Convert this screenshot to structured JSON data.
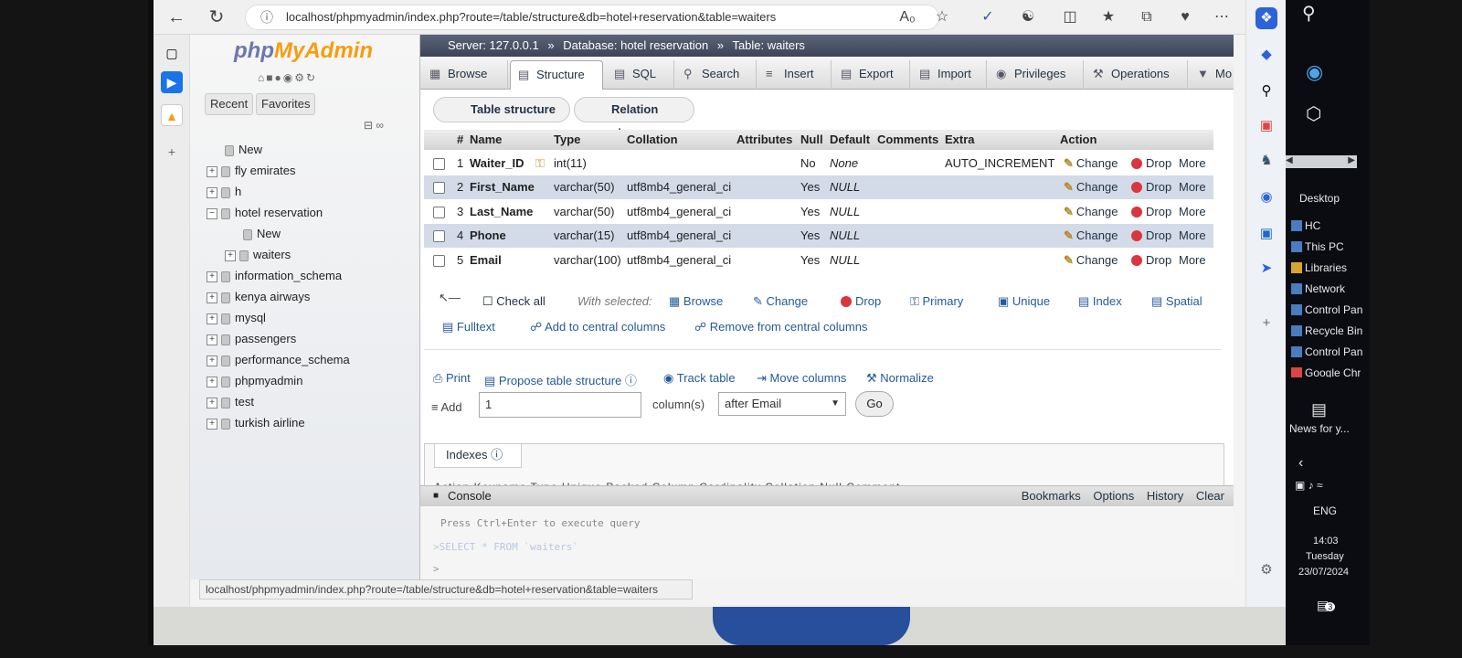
{
  "browser": {
    "url": "localhost/phpmyadmin/index.php?route=/table/structure&db=hotel+reservation&table=waiters"
  },
  "pma": {
    "logo_php": "php",
    "logo_myadmin": "MyAdmin",
    "left_tabs": [
      "Recent",
      "Favorites"
    ],
    "tree": [
      {
        "label": "New",
        "indent": 0
      },
      {
        "label": "fly emirates",
        "indent": 0
      },
      {
        "label": "h",
        "indent": 0
      },
      {
        "label": "hotel reservation",
        "indent": 0
      },
      {
        "label": "New",
        "indent": 1
      },
      {
        "label": "waiters",
        "indent": 1
      },
      {
        "label": "information_schema",
        "indent": 0
      },
      {
        "label": "kenya airways",
        "indent": 0
      },
      {
        "label": "mysql",
        "indent": 0
      },
      {
        "label": "passengers",
        "indent": 0
      },
      {
        "label": "performance_schema",
        "indent": 0
      },
      {
        "label": "phpmyadmin",
        "indent": 0
      },
      {
        "label": "test",
        "indent": 0
      },
      {
        "label": "turkish airline",
        "indent": 0
      }
    ],
    "breadcrumb": {
      "server": "Server: 127.0.0.1",
      "database": "Database: hotel reservation",
      "table": "Table: waiters"
    },
    "tabs": [
      "Browse",
      "Structure",
      "SQL",
      "Search",
      "Insert",
      "Export",
      "Import",
      "Privileges",
      "Operations",
      "Mo"
    ],
    "active_tab": "Structure",
    "subtabs": [
      "Table structure",
      "Relation view"
    ],
    "columns_header": [
      "#",
      "Name",
      "Type",
      "Collation",
      "Attributes",
      "Null",
      "Default",
      "Comments",
      "Extra",
      "Action"
    ],
    "rows": [
      {
        "num": "1",
        "name": "Waiter_ID",
        "type": "int(11)",
        "collation": "",
        "null": "No",
        "default": "None",
        "extra": "AUTO_INCREMENT"
      },
      {
        "num": "2",
        "name": "First_Name",
        "type": "varchar(50)",
        "collation": "utf8mb4_general_ci",
        "null": "Yes",
        "default": "NULL",
        "extra": ""
      },
      {
        "num": "3",
        "name": "Last_Name",
        "type": "varchar(50)",
        "collation": "utf8mb4_general_ci",
        "null": "Yes",
        "default": "NULL",
        "extra": ""
      },
      {
        "num": "4",
        "name": "Phone",
        "type": "varchar(15)",
        "collation": "utf8mb4_general_ci",
        "null": "Yes",
        "default": "NULL",
        "extra": ""
      },
      {
        "num": "5",
        "name": "Email",
        "type": "varchar(100)",
        "collation": "utf8mb4_general_ci",
        "null": "Yes",
        "default": "NULL",
        "extra": ""
      }
    ],
    "row_actions": [
      "Change",
      "Drop",
      "More"
    ],
    "bulk": {
      "check_all": "Check all",
      "with_selected": "With selected:",
      "actions": [
        "Browse",
        "Change",
        "Drop",
        "Primary",
        "Unique",
        "Index",
        "Spatial"
      ],
      "actions2": [
        "Fulltext",
        "Add to central columns",
        "Remove from central columns"
      ]
    },
    "tools": [
      "Print",
      "Propose table structure",
      "Track table",
      "Move columns",
      "Normalize"
    ],
    "add": {
      "label": "Add",
      "count": "1",
      "unit": "column(s)",
      "position": "after Email",
      "go": "Go"
    },
    "indexes_label": "Indexes",
    "index_columns": "Action      Keyname  Type    Unique  Packed  Column    Cardinality  Collation  Null  Comment",
    "console": {
      "label": "Console",
      "right": [
        "Bookmarks",
        "Options",
        "History",
        "Clear"
      ],
      "hint": "Press Ctrl+Enter to execute query",
      "last_query": ">SELECT * FROM `waiters`",
      "prompt": ">"
    },
    "status_url": "localhost/phpmyadmin/index.php?route=/table/structure&db=hotel+reservation&table=waiters"
  },
  "desktop": {
    "items": [
      "Desktop",
      "HC",
      "This PC",
      "Libraries",
      "Network",
      "Control Pan",
      "Recycle Bin",
      "Control Pan",
      "Google Chr"
    ],
    "news": "News for y...",
    "lang": "ENG",
    "time": "14:03",
    "day": "Tuesday",
    "date": "23/07/2024",
    "notif_count": "3"
  }
}
